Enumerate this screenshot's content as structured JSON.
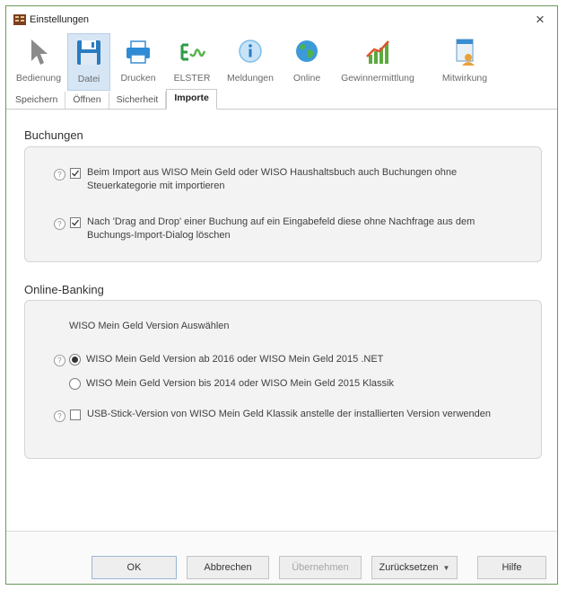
{
  "window": {
    "title": "Einstellungen",
    "close_glyph": "×"
  },
  "toolbar": {
    "items": [
      {
        "label": "Bedienung",
        "icon": "cursor-arrow-icon"
      },
      {
        "label": "Datei",
        "icon": "floppy-disk-icon",
        "active": true
      },
      {
        "label": "Drucken",
        "icon": "printer-icon"
      },
      {
        "label": "ELSTER",
        "icon": "elster-icon"
      },
      {
        "label": "Meldungen",
        "icon": "info-icon"
      },
      {
        "label": "Online",
        "icon": "globe-icon"
      },
      {
        "label": "Gewinnermittlung",
        "icon": "bar-chart-icon"
      },
      {
        "label": "Mitwirkung",
        "icon": "document-person-icon"
      }
    ]
  },
  "subtabs": [
    {
      "label": "Speichern"
    },
    {
      "label": "Öffnen"
    },
    {
      "label": "Sicherheit"
    },
    {
      "label": "Importe",
      "active": true
    }
  ],
  "buchungen": {
    "title": "Buchungen",
    "options": [
      {
        "text": "Beim Import aus WISO Mein Geld oder WISO Haushaltsbuch auch Buchungen ohne Steuerkategorie mit importieren",
        "checked": true
      },
      {
        "text": "Nach 'Drag and Drop' einer Buchung auf ein Eingabefeld diese ohne Nachfrage aus dem Buchungs-Import-Dialog löschen",
        "checked": true
      }
    ]
  },
  "online_banking": {
    "title": "Online-Banking",
    "version_heading": "WISO Mein Geld Version Auswählen",
    "radios": [
      {
        "text": "WISO Mein Geld Version ab 2016 oder WISO Mein Geld 2015 .NET",
        "selected": true
      },
      {
        "text": "WISO Mein Geld Version bis 2014 oder WISO Mein Geld 2015 Klassik",
        "selected": false
      }
    ],
    "usb_option": {
      "text": "USB-Stick-Version von WISO Mein Geld Klassik anstelle der installierten Version verwenden",
      "checked": false
    }
  },
  "footer": {
    "ok": "OK",
    "cancel": "Abbrechen",
    "apply": "Übernehmen",
    "reset": "Zurücksetzen",
    "help": "Hilfe"
  },
  "help_glyph": "?"
}
